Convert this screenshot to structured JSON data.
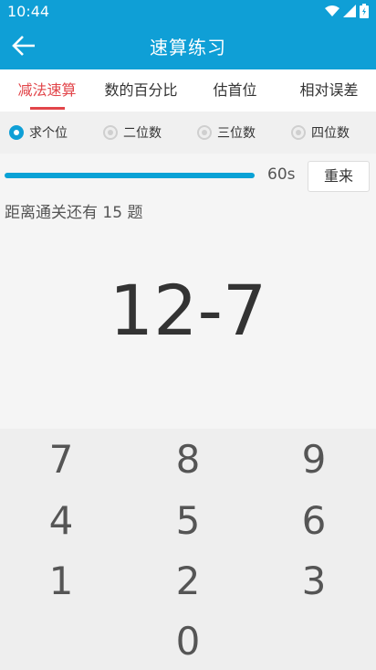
{
  "status": {
    "time": "10:44"
  },
  "app_bar": {
    "title": "速算练习"
  },
  "tabs": [
    {
      "label": "减法速算"
    },
    {
      "label": "数的百分比"
    },
    {
      "label": "估首位"
    },
    {
      "label": "相对误差"
    }
  ],
  "modes": [
    {
      "label": "求个位",
      "checked": true
    },
    {
      "label": "二位数",
      "checked": false
    },
    {
      "label": "三位数",
      "checked": false
    },
    {
      "label": "四位数",
      "checked": false
    }
  ],
  "progress": {
    "timer": "60s",
    "fraction": 1.0
  },
  "restart_label": "重来",
  "remaining_text": "距离通关还有 15 题",
  "question": "12-7",
  "keypad": {
    "keys": [
      "7",
      "8",
      "9",
      "4",
      "5",
      "6",
      "1",
      "2",
      "3",
      "0"
    ]
  },
  "colors": {
    "accent": "#0f9fd6",
    "tab_active": "#e2454a"
  }
}
